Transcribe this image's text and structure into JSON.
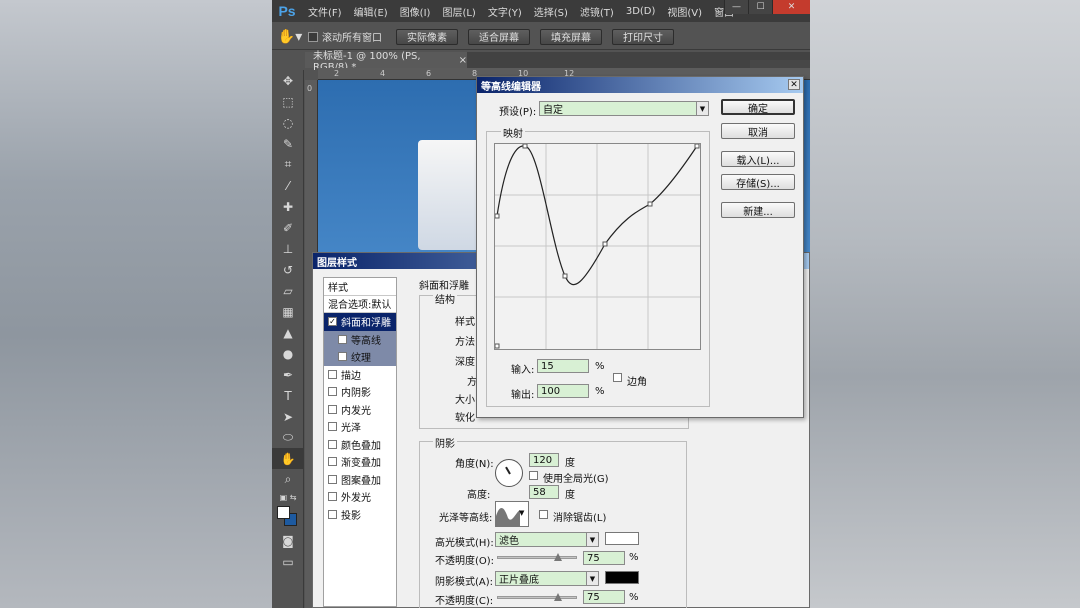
{
  "app": {
    "logo": "Ps",
    "menu": [
      "文件(F)",
      "编辑(E)",
      "图像(I)",
      "图层(L)",
      "文字(Y)",
      "选择(S)",
      "滤镜(T)",
      "3D(D)",
      "视图(V)",
      "窗口"
    ],
    "window_buttons": [
      "—",
      "☐",
      "✕"
    ]
  },
  "options_bar": {
    "scroll_all_label": "滚动所有窗口",
    "buttons": [
      "实际像素",
      "适合屏幕",
      "填充屏幕",
      "打印尺寸"
    ]
  },
  "document": {
    "tab_title": "未标题-1 @ 100% (PS, RGB/8) *",
    "ruler_ticks": [
      "2",
      "4",
      "6",
      "8",
      "10",
      "12"
    ],
    "vertical_ruler_tick": "0"
  },
  "tools": [
    "move-icon",
    "marquee-icon",
    "lasso-icon",
    "quick-select-icon",
    "crop-icon",
    "eyedropper-icon",
    "healing-icon",
    "brush-icon",
    "stamp-icon",
    "history-brush-icon",
    "eraser-icon",
    "gradient-icon",
    "blur-icon",
    "dodge-icon",
    "pen-icon",
    "type-icon",
    "path-select-icon",
    "shape-icon",
    "hand-icon",
    "zoom-icon"
  ],
  "layer_style": {
    "title": "图层样式",
    "list": {
      "styles_header": "样式",
      "blend_options": "混合选项:默认",
      "items": [
        {
          "label": "斜面和浮雕",
          "checked": true,
          "selected": true
        },
        {
          "label": "等高线",
          "checked": false,
          "sub": true
        },
        {
          "label": "纹理",
          "checked": false,
          "sub": true
        },
        {
          "label": "描边",
          "checked": false
        },
        {
          "label": "内阴影",
          "checked": false
        },
        {
          "label": "内发光",
          "checked": false
        },
        {
          "label": "光泽",
          "checked": false
        },
        {
          "label": "颜色叠加",
          "checked": false
        },
        {
          "label": "渐变叠加",
          "checked": false
        },
        {
          "label": "图案叠加",
          "checked": false
        },
        {
          "label": "外发光",
          "checked": false
        },
        {
          "label": "投影",
          "checked": false
        }
      ]
    },
    "section_title": "斜面和浮雕",
    "structure": {
      "title": "结构",
      "labels": [
        "样式",
        "方法",
        "深度",
        "方",
        "大小",
        "软化"
      ]
    },
    "shading": {
      "title": "阴影",
      "angle_label": "角度(N):",
      "angle_value": "120",
      "degree": "度",
      "global_light_label": "使用全局光(G)",
      "altitude_label": "高度:",
      "altitude_value": "58",
      "gloss_contour_label": "光泽等高线:",
      "anti_alias_label": "消除锯齿(L)",
      "highlight_mode_label": "高光模式(H):",
      "highlight_mode_value": "滤色",
      "highlight_color": "#ffffff",
      "highlight_opacity_label": "不透明度(O):",
      "highlight_opacity_value": "75",
      "shadow_mode_label": "阴影模式(A):",
      "shadow_mode_value": "正片叠底",
      "shadow_color": "#000000",
      "shadow_opacity_label": "不透明度(C):",
      "shadow_opacity_value": "75",
      "percent": "%"
    }
  },
  "contour_editor": {
    "title": "等高线编辑器",
    "close": "✕",
    "preset_label": "预设(P):",
    "preset_value": "自定",
    "mapping_title": "映射",
    "input_label": "输入:",
    "input_value": "15",
    "output_label": "输出:",
    "output_value": "100",
    "percent": "%",
    "corner_label": "边角",
    "buttons": {
      "ok": "确定",
      "cancel": "取消",
      "load": "载入(L)...",
      "save": "存储(S)...",
      "new": "新建..."
    }
  }
}
